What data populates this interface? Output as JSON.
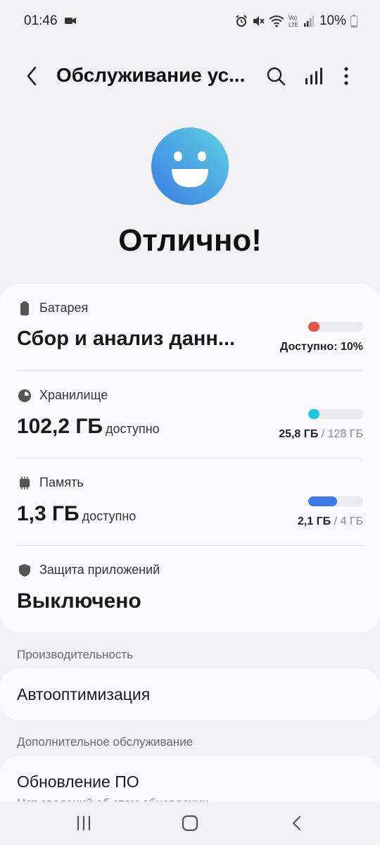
{
  "status_bar": {
    "time": "01:46",
    "battery_percent": "10%",
    "icons": [
      "video-camera-icon",
      "alarm-icon",
      "mute-icon",
      "wifi-icon",
      "volte-icon",
      "signal-icon",
      "battery-icon"
    ]
  },
  "app_bar": {
    "title": "Обслуживание ус...",
    "icons": [
      "back-arrow-icon",
      "search-icon",
      "bar-chart-icon",
      "more-vertical-icon"
    ]
  },
  "hero": {
    "icon": "smile-face-icon",
    "status": "Отлично!"
  },
  "sections": {
    "battery": {
      "label": "Батарея",
      "value": "Сбор и анализ данн...",
      "bar_text": "Доступно: 10%",
      "level": 0.1,
      "color": "#e0554a"
    },
    "storage": {
      "label": "Хранилище",
      "value": "102,2 ГБ",
      "unit": "доступно",
      "used": "25,8 ГБ",
      "total": "/ 128 ГБ",
      "level": 0.2,
      "color": "#1fc6e0"
    },
    "memory": {
      "label": "Память",
      "value": "1,3 ГБ",
      "unit": "доступно",
      "used": "2,1 ГБ",
      "total": "/ 4 ГБ",
      "level": 0.525,
      "color": "#3a7be6"
    },
    "app_protection": {
      "label": "Защита приложений",
      "value": "Выключено"
    }
  },
  "performance": {
    "group_label": "Производительность",
    "item": "Автооптимизация"
  },
  "additional": {
    "group_label": "Дополнительное обслуживание",
    "item_title": "Обновление ПО",
    "item_subtitle": "Нет сведений об этом обновлении"
  },
  "nav_bar": {
    "icons": [
      "recent-apps-icon",
      "home-icon",
      "back-icon"
    ]
  },
  "colors": {
    "background": "#f2f2f5",
    "card": "#fbfbfd",
    "accent_gradient_start": "#5fd2e0",
    "accent_gradient_end": "#3a7be6"
  }
}
